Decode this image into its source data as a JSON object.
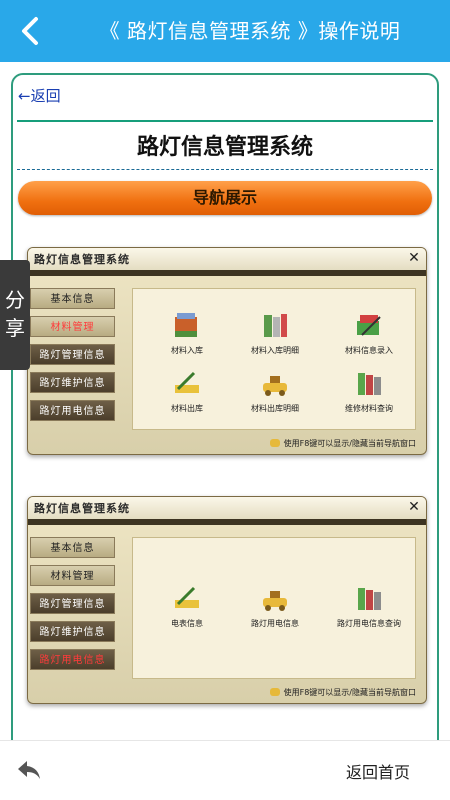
{
  "header": {
    "title": "《 路灯信息管理系统 》操作说明",
    "back_icon": "chevron-left-icon",
    "color": "#29a8e9"
  },
  "article": {
    "back_link": "←返回",
    "title": "路灯信息管理系统",
    "nav_pill": "导航展示"
  },
  "share": {
    "label_1": "分",
    "label_2": "享"
  },
  "screenshot1": {
    "window_title": "路灯信息管理系统",
    "menu": [
      "基本信息",
      "材料管理",
      "路灯管理信息",
      "路灯维护信息",
      "路灯用电信息"
    ],
    "items": [
      "材料入库",
      "材料入库明细",
      "材料信息录入",
      "材料出库",
      "材料出库明细",
      "维修材料查询"
    ],
    "hint": "使用F8键可以显示/隐藏当前导航窗口"
  },
  "screenshot2": {
    "window_title": "路灯信息管理系统",
    "menu": [
      "基本信息",
      "材料管理",
      "路灯管理信息",
      "路灯维护信息",
      "路灯用电信息"
    ],
    "items": [
      "电表信息",
      "路灯用电信息",
      "路灯用电信息查询"
    ],
    "hint": "使用F8键可以显示/隐藏当前导航窗口"
  },
  "footer": {
    "reply_icon": "reply-arrow-icon",
    "home_label": "返回首页"
  }
}
